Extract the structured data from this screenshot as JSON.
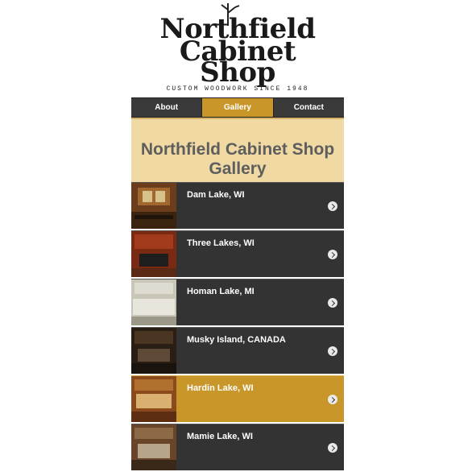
{
  "header": {
    "logo_line1": "Northfield",
    "logo_line2": "Cabinet",
    "logo_line3": "Shop",
    "tagline": "Custom woodwork since 1948"
  },
  "nav": [
    {
      "label": "About",
      "active": false
    },
    {
      "label": "Gallery",
      "active": true
    },
    {
      "label": "Contact",
      "active": false
    }
  ],
  "hero": {
    "title": "Northfield Cabinet Shop Gallery"
  },
  "gallery": [
    {
      "title": "Dam Lake, WI",
      "active": false
    },
    {
      "title": "Three Lakes, WI",
      "active": false
    },
    {
      "title": "Homan Lake, MI",
      "active": false
    },
    {
      "title": "Musky Island, CANADA",
      "active": false
    },
    {
      "title": "Hardin Lake, WI",
      "active": true
    },
    {
      "title": "Mamie Lake, WI",
      "active": false
    }
  ],
  "colors": {
    "accent": "#c9962a",
    "hero_bg": "#f0d9a3",
    "list_bg": "#333333"
  }
}
